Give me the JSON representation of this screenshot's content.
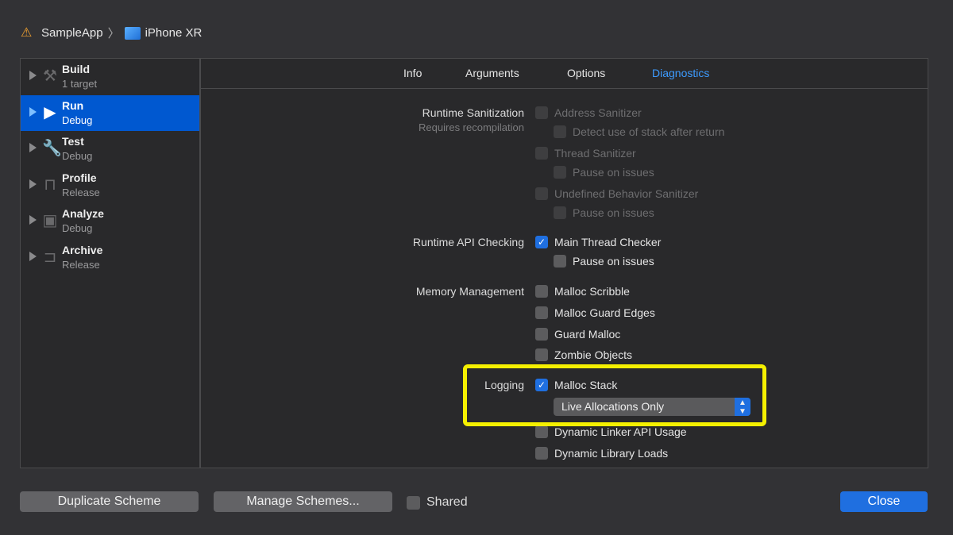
{
  "breadcrumb": {
    "project": "SampleApp",
    "separator": "〉",
    "device": "iPhone XR"
  },
  "sidebar": {
    "items": [
      {
        "title": "Build",
        "subtitle": "1 target",
        "icon": "hammer-icon",
        "glyph": "⚒",
        "selected": false
      },
      {
        "title": "Run",
        "subtitle": "Debug",
        "icon": "play-icon",
        "glyph": "▶",
        "selected": true
      },
      {
        "title": "Test",
        "subtitle": "Debug",
        "icon": "wrench-icon",
        "glyph": "🔧",
        "selected": false
      },
      {
        "title": "Profile",
        "subtitle": "Release",
        "icon": "gauge-icon",
        "glyph": "⊓",
        "selected": false
      },
      {
        "title": "Analyze",
        "subtitle": "Debug",
        "icon": "analyze-icon",
        "glyph": "▣",
        "selected": false
      },
      {
        "title": "Archive",
        "subtitle": "Release",
        "icon": "archive-icon",
        "glyph": "⊐",
        "selected": false
      }
    ]
  },
  "tabs": [
    {
      "label": "Info"
    },
    {
      "label": "Arguments"
    },
    {
      "label": "Options"
    },
    {
      "label": "Diagnostics",
      "active": true
    }
  ],
  "sections": {
    "runtime_sanitization": "Runtime Sanitization",
    "requires_recompilation": "Requires recompilation",
    "runtime_api": "Runtime API Checking",
    "memory": "Memory Management",
    "logging": "Logging"
  },
  "options": [
    {
      "label": "Address Sanitizer",
      "checked": false,
      "disabled": true
    },
    {
      "label": "Detect use of stack after return",
      "checked": false,
      "disabled": true,
      "indent": true
    },
    {
      "label": "Thread Sanitizer",
      "checked": false,
      "disabled": true
    },
    {
      "label": "Pause on issues",
      "checked": false,
      "disabled": true,
      "indent": true
    },
    {
      "label": "Undefined Behavior Sanitizer",
      "checked": false,
      "disabled": true
    },
    {
      "label": "Pause on issues",
      "checked": false,
      "disabled": true,
      "indent": true
    },
    {
      "label": "Main Thread Checker",
      "checked": true
    },
    {
      "label": "Pause on issues",
      "checked": false,
      "indent": true
    },
    {
      "label": "Malloc Scribble",
      "checked": false
    },
    {
      "label": "Malloc Guard Edges",
      "checked": false
    },
    {
      "label": "Guard Malloc",
      "checked": false
    },
    {
      "label": "Zombie Objects",
      "checked": false
    },
    {
      "label": "Malloc Stack",
      "checked": true
    },
    {
      "label": "Dynamic Linker API Usage",
      "checked": false
    },
    {
      "label": "Dynamic Library Loads",
      "checked": false
    }
  ],
  "malloc_stack_mode": "Live Allocations Only",
  "footer": {
    "duplicate": "Duplicate Scheme",
    "manage": "Manage Schemes...",
    "shared": "Shared",
    "shared_checked": false,
    "close": "Close"
  },
  "colors": {
    "accent": "#1f6fe0",
    "highlight": "#f5f000",
    "selection": "#0058d0"
  }
}
